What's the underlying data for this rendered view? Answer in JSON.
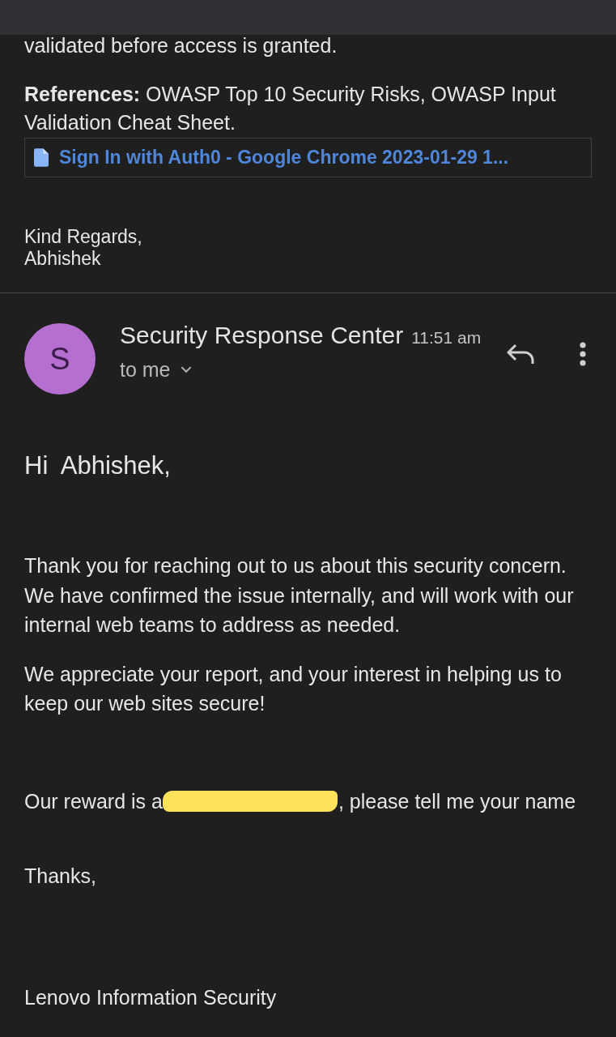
{
  "previous_message": {
    "body_tail": "validated before access is granted.",
    "references": "**References:** OWASP Top 10 Security Risks, OWASP Input Validation Cheat Sheet.",
    "attachment": {
      "name": "Sign In with Auth0 - Google Chrome 2023-01-29 1..."
    },
    "signature": [
      "Kind Regards,",
      "Abhishek"
    ]
  },
  "message": {
    "sender": {
      "initial": "S",
      "name": "Security Response Center"
    },
    "time": "11:51 am",
    "recipient": "to me",
    "greeting": "Hi  Abhishek,",
    "paragraphs": [
      "Thank you for reaching out to us about this security concern. We have confirmed the issue internally, and will work with our internal web teams to address as needed.",
      "We appreciate your report, and your interest in helping us to keep our web sites secure!"
    ],
    "reward_line": {
      "before": "Our reward is a",
      "redacted": true,
      "after": ", please tell me your name"
    },
    "closing": "Thanks,",
    "signature": "Lenovo Information Security"
  }
}
